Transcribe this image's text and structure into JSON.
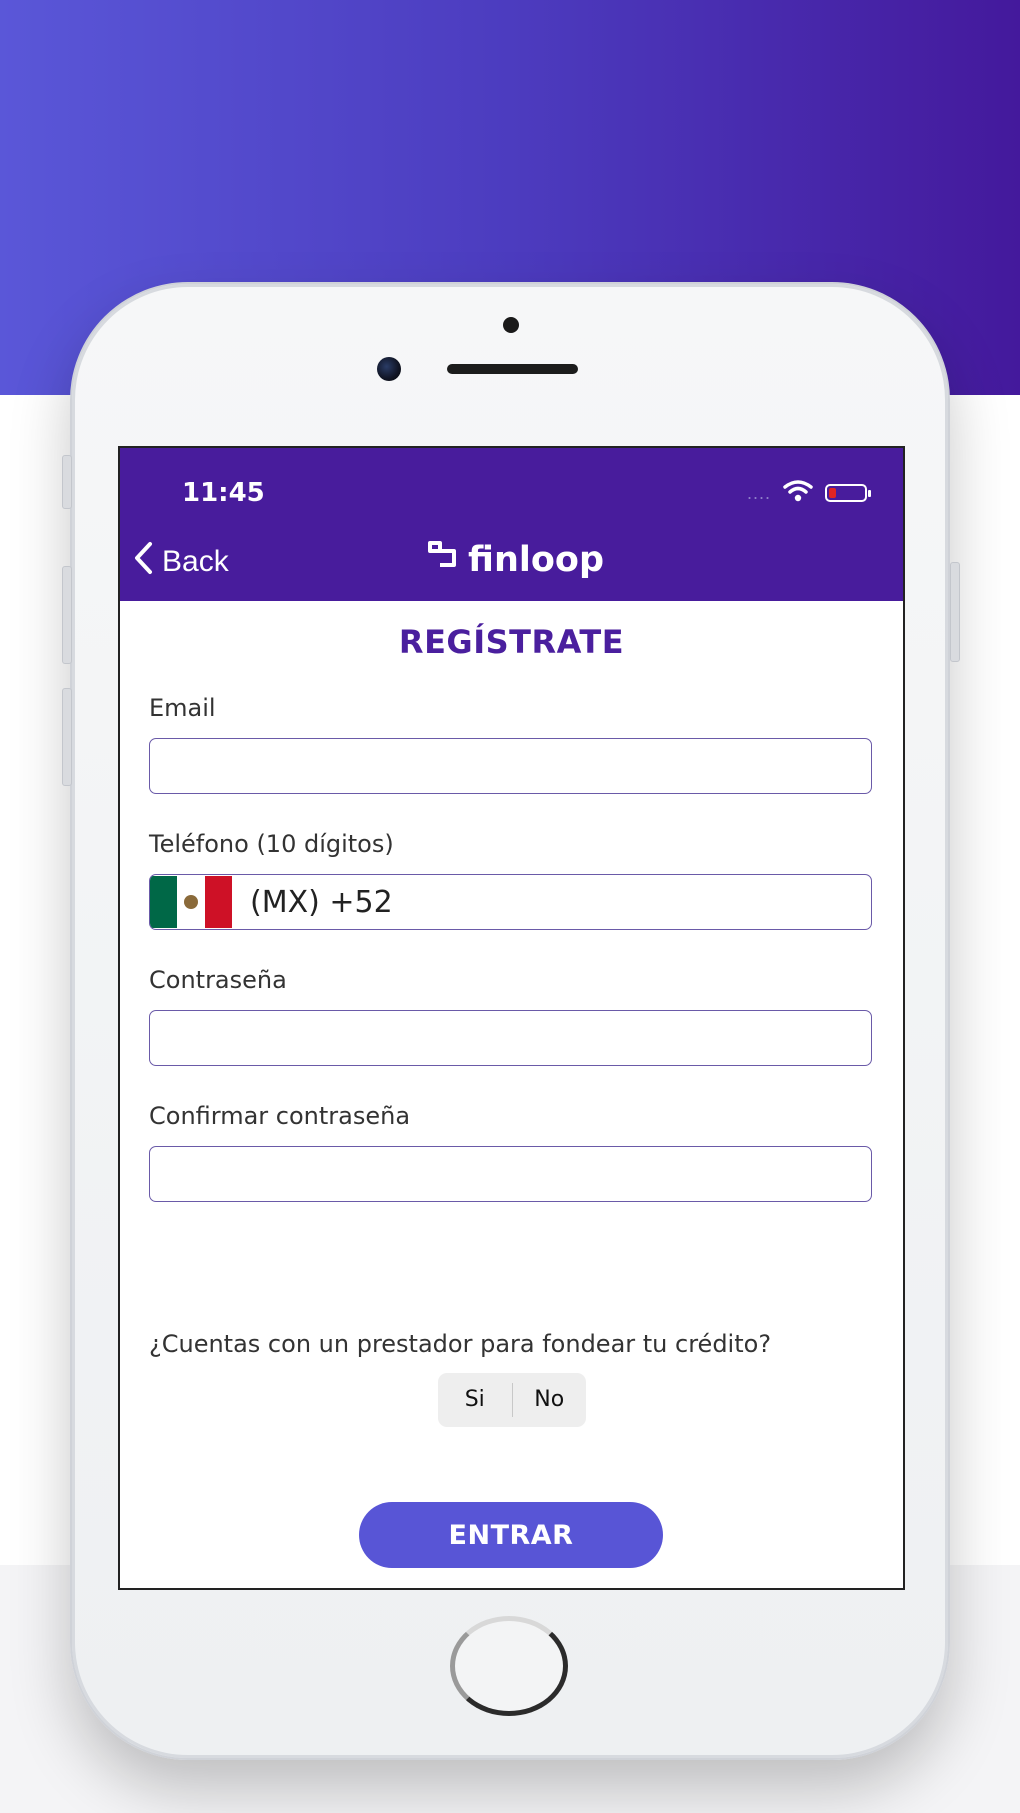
{
  "status_bar": {
    "time": "11:45",
    "signal_dots": "....",
    "wifi_icon": "wifi-icon",
    "battery_icon": "battery-low-icon",
    "battery_color": "#e02424"
  },
  "nav": {
    "back_label": "Back",
    "logo_text": "finloop",
    "header_color": "#481c9c"
  },
  "form": {
    "title": "REGÍSTRATE",
    "email_label": "Email",
    "email_value": "",
    "phone_label": "Teléfono (10 dígitos)",
    "phone_country_code": "(MX) +52",
    "password_label": "Contraseña",
    "password_value": "",
    "confirm_label": "Confirmar contraseña",
    "confirm_value": "",
    "question": "¿Cuentas con un prestador para fondear tu crédito?",
    "options": [
      "Si",
      "No"
    ],
    "submit_label": "ENTRAR",
    "accent_color": "#5855d6"
  }
}
